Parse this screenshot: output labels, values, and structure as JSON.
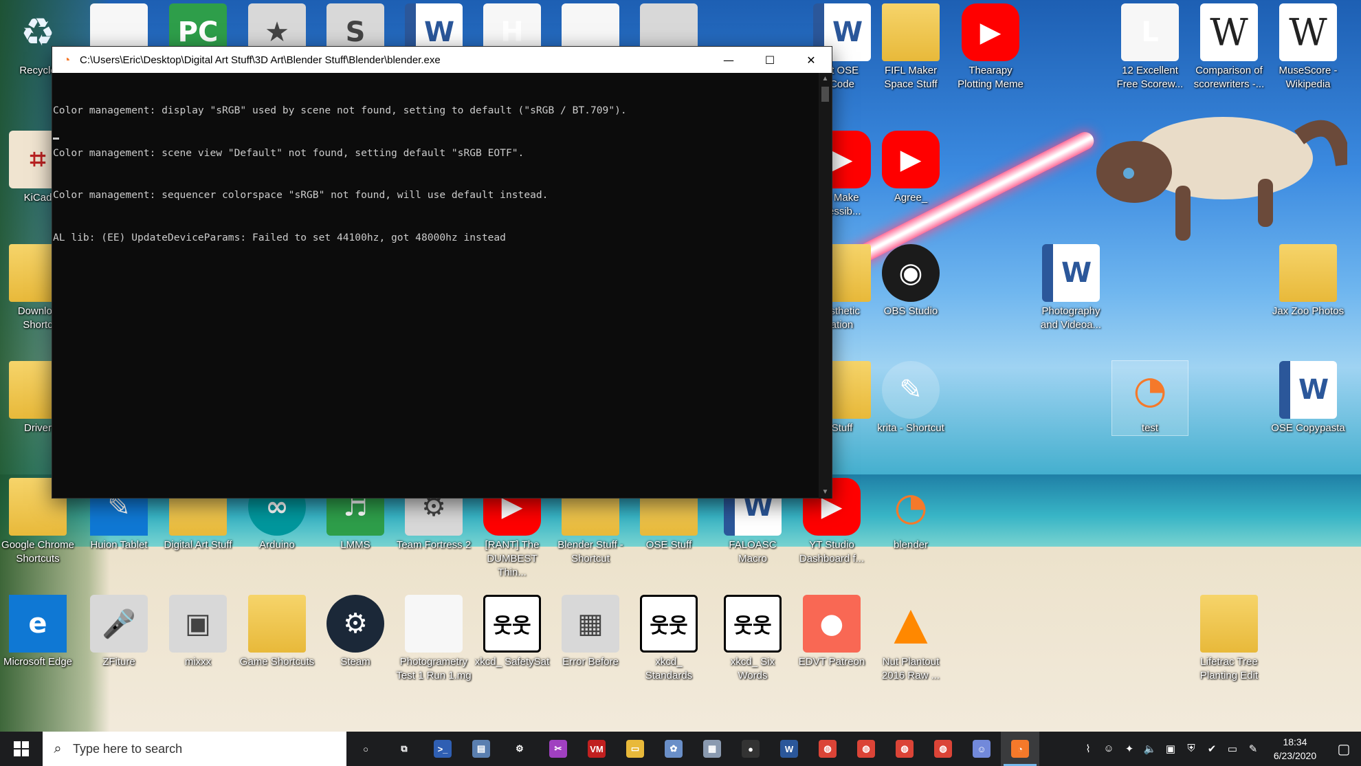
{
  "desktop": {
    "icons": [
      {
        "label": "Recycle",
        "icon": "recycle-bin-icon",
        "glyph": "♻"
      },
      {
        "label": "",
        "icon": "file-icon",
        "glyph": ""
      },
      {
        "label": "",
        "icon": "pycharm-icon",
        "glyph": "PC"
      },
      {
        "label": "",
        "icon": "star-icon",
        "glyph": "★"
      },
      {
        "label": "",
        "icon": "app-s-icon",
        "glyph": "S"
      },
      {
        "label": "",
        "icon": "word-doc-icon",
        "glyph": "W"
      },
      {
        "label": "",
        "icon": "app-h-icon",
        "glyph": "H"
      },
      {
        "label": "",
        "icon": "file-icon",
        "glyph": ""
      },
      {
        "label": "",
        "icon": "screenshot-icon",
        "glyph": ""
      },
      {
        "label": "nt OSE\nCode",
        "icon": "word-doc-icon",
        "glyph": "W"
      },
      {
        "label": "FIFL Maker\nSpace Stuff",
        "icon": "folder-icon",
        "glyph": ""
      },
      {
        "label": "Thearapy\nPlotting Meme",
        "icon": "youtube-icon",
        "glyph": "▶"
      },
      {
        "label": "12 Excellent\nFree Scorew...",
        "icon": "app-l-icon",
        "glyph": "L"
      },
      {
        "label": "Comparison of\nscorewriters -...",
        "icon": "wikipedia-icon",
        "glyph": "W"
      },
      {
        "label": "MuseScore -\nWikipedia",
        "icon": "wikipedia-icon",
        "glyph": "W"
      },
      {
        "label": "KiCad",
        "icon": "kicad-icon",
        "glyph": "⌗"
      },
      {
        "label": "o Make\ncessib...",
        "icon": "youtube-icon",
        "glyph": "▶"
      },
      {
        "label": "Agree_",
        "icon": "youtube-icon",
        "glyph": "▶"
      },
      {
        "label": "Downloa\nShortc",
        "icon": "folder-icon",
        "glyph": ""
      },
      {
        "label": "esthetic\nation",
        "icon": "folder-icon",
        "glyph": ""
      },
      {
        "label": "OBS Studio",
        "icon": "obs-icon",
        "glyph": "◉"
      },
      {
        "label": "Photography\nand Videoa...",
        "icon": "word-doc-icon",
        "glyph": "W"
      },
      {
        "label": "Jax Zoo Photos",
        "icon": "folder-icon",
        "glyph": ""
      },
      {
        "label": "Driver",
        "icon": "folder-icon",
        "glyph": ""
      },
      {
        "label": "Stuff",
        "icon": "folder-icon",
        "glyph": ""
      },
      {
        "label": "krita - Shortcut",
        "icon": "krita-icon",
        "glyph": "✎"
      },
      {
        "label": "test",
        "icon": "blender-icon",
        "glyph": "◔"
      },
      {
        "label": "OSE Copypasta",
        "icon": "word-doc-icon",
        "glyph": "W"
      },
      {
        "label": "Google Chrome\nShortcuts",
        "icon": "folder-icon",
        "glyph": ""
      },
      {
        "label": "Huion Tablet",
        "icon": "huion-icon",
        "glyph": "✎"
      },
      {
        "label": "Digital Art Stuff",
        "icon": "folder-icon",
        "glyph": ""
      },
      {
        "label": "Arduino",
        "icon": "arduino-icon",
        "glyph": "∞"
      },
      {
        "label": "LMMS",
        "icon": "lmms-icon",
        "glyph": "♬"
      },
      {
        "label": "Team Fortress 2",
        "icon": "tf2-icon",
        "glyph": "⚙"
      },
      {
        "label": "[RANT] The\nDUMBEST Thin...",
        "icon": "youtube-icon",
        "glyph": "▶"
      },
      {
        "label": "Blender Stuff -\nShortcut",
        "icon": "folder-icon",
        "glyph": ""
      },
      {
        "label": "OSE Stuff",
        "icon": "folder-icon",
        "glyph": ""
      },
      {
        "label": "FALOASC Macro",
        "icon": "word-doc-icon",
        "glyph": "W"
      },
      {
        "label": "YT Studio\nDashboard f...",
        "icon": "youtube-icon",
        "glyph": "▶"
      },
      {
        "label": "blender",
        "icon": "blender-icon",
        "glyph": "◔"
      },
      {
        "label": "Microsoft Edge",
        "icon": "edge-icon",
        "glyph": "e"
      },
      {
        "label": "ZFiture",
        "icon": "microphone-icon",
        "glyph": "🎤"
      },
      {
        "label": "mixxx",
        "icon": "mixxx-icon",
        "glyph": "▣"
      },
      {
        "label": "Game Shortcuts",
        "icon": "folder-icon",
        "glyph": ""
      },
      {
        "label": "Steam",
        "icon": "steam-icon",
        "glyph": "⚙"
      },
      {
        "label": "Photogrametry\nTest 1 Run 1.mg",
        "icon": "file-icon",
        "glyph": ""
      },
      {
        "label": "xkcd_ SafetySat",
        "icon": "xkcd-icon",
        "glyph": "웃웃"
      },
      {
        "label": "Error Before",
        "icon": "image-icon",
        "glyph": "▦"
      },
      {
        "label": "xkcd_ Standards",
        "icon": "xkcd-icon",
        "glyph": "웃웃"
      },
      {
        "label": "xkcd_ Six Words",
        "icon": "xkcd-icon",
        "glyph": "웃웃"
      },
      {
        "label": "EDVT Patreon",
        "icon": "patreon-icon",
        "glyph": "●"
      },
      {
        "label": "Nut Plantout\n2016 Raw ...",
        "icon": "vlc-icon",
        "glyph": "▲"
      },
      {
        "label": "Lifetrac Tree\nPlanting Edit",
        "icon": "blender-folder-icon",
        "glyph": ""
      }
    ]
  },
  "console": {
    "title": "C:\\Users\\Eric\\Desktop\\Digital Art Stuff\\3D Art\\Blender Stuff\\Blender\\blender.exe",
    "lines": [
      "Color management: display \"sRGB\" used by scene not found, setting to default (\"sRGB / BT.709\").",
      "Color management: scene view \"Default\" not found, setting default \"sRGB EOTF\".",
      "Color management: sequencer colorspace \"sRGB\" not found, will use default instead.",
      "AL lib: (EE) UpdateDeviceParams: Failed to set 44100hz, got 48000hz instead"
    ],
    "minimize_glyph": "—",
    "maximize_glyph": "☐",
    "close_glyph": "✕"
  },
  "taskbar": {
    "search_placeholder": "Type here to search",
    "apps": [
      {
        "name": "cortana-icon",
        "glyph": "○",
        "color": ""
      },
      {
        "name": "task-view-icon",
        "glyph": "⧉",
        "color": ""
      },
      {
        "name": "powershell-icon",
        "glyph": ">_",
        "color": "#2f5fb3"
      },
      {
        "name": "remote-desktop-icon",
        "glyph": "▤",
        "color": "#5a7fb0"
      },
      {
        "name": "settings-gear-icon",
        "glyph": "⚙",
        "color": ""
      },
      {
        "name": "screen-sketch-icon",
        "glyph": "✂",
        "color": "#a040c0"
      },
      {
        "name": "voicemeeter-icon",
        "glyph": "VM",
        "color": "#c02020"
      },
      {
        "name": "file-explorer-icon",
        "glyph": "▭",
        "color": "#e8b93a"
      },
      {
        "name": "paint-icon",
        "glyph": "✿",
        "color": "#6a8fc8"
      },
      {
        "name": "scanner-icon",
        "glyph": "▦",
        "color": "#8a9ab0"
      },
      {
        "name": "microphone-icon",
        "glyph": "●",
        "color": "#333333"
      },
      {
        "name": "word-icon",
        "glyph": "W",
        "color": "#2b579a"
      },
      {
        "name": "chrome-icon",
        "glyph": "◍",
        "color": "#db4437"
      },
      {
        "name": "chrome-icon",
        "glyph": "◍",
        "color": "#db4437"
      },
      {
        "name": "chrome-icon",
        "glyph": "◍",
        "color": "#db4437"
      },
      {
        "name": "chrome-icon",
        "glyph": "◍",
        "color": "#db4437"
      },
      {
        "name": "discord-icon",
        "glyph": "☺",
        "color": "#7289da"
      },
      {
        "name": "blender-icon",
        "glyph": "◔",
        "color": "#f5792a"
      }
    ],
    "tray": [
      {
        "name": "network-icon",
        "glyph": "⌇"
      },
      {
        "name": "discord-tray-icon",
        "glyph": "☺"
      },
      {
        "name": "dropbox-icon",
        "glyph": "✦"
      },
      {
        "name": "volume-icon",
        "glyph": "🔈"
      },
      {
        "name": "app-tray-icon",
        "glyph": "▣"
      },
      {
        "name": "shield-icon",
        "glyph": "⛨"
      },
      {
        "name": "security-icon",
        "glyph": "✔"
      },
      {
        "name": "battery-icon",
        "glyph": "▭"
      },
      {
        "name": "pen-icon",
        "glyph": "✎"
      }
    ],
    "time": "18:34",
    "date": "6/23/2020",
    "notification_glyph": "▢"
  }
}
